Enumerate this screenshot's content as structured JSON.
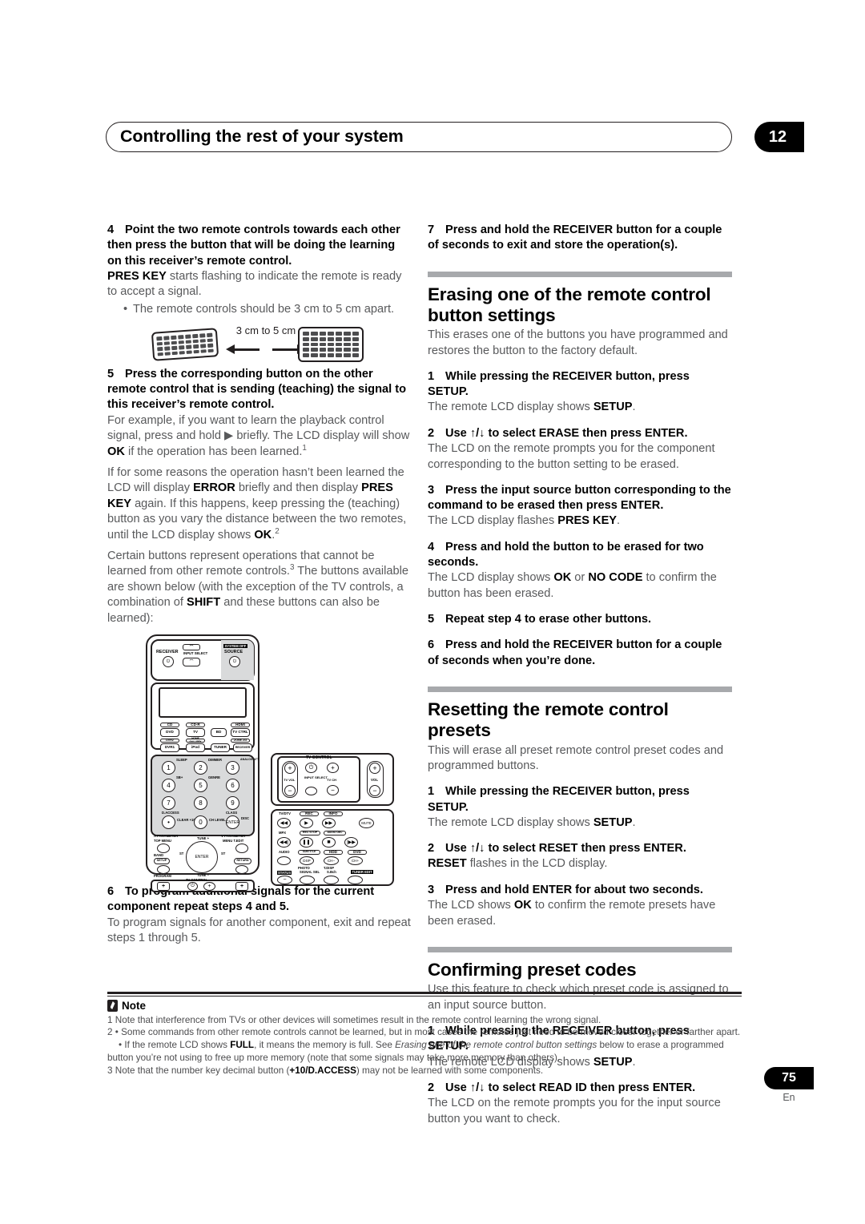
{
  "header": {
    "title": "Controlling the rest of your system",
    "chapter": "12"
  },
  "left_column": {
    "step4": {
      "num": "4",
      "title": "Point the two remote controls towards each other then press the button that will be doing the learning on this receiver’s remote control.",
      "body_prefix": "PRES KEY",
      "body_rest": " starts flashing to indicate the remote is ready to accept a signal.",
      "bullet1": "The remote controls should be 3 cm to 5 cm apart."
    },
    "distance_figure": {
      "label": "3 cm to 5 cm"
    },
    "step5": {
      "num": "5",
      "title": "Press the corresponding button on the other remote control that is sending (teaching) the signal to this receiver’s remote control.",
      "para1_a": "For example, if you want to learn the playback control signal, press and hold ",
      "para1_play": "▶",
      "para1_b": " briefly. The LCD display will show ",
      "para1_ok": "OK",
      "para1_c": " if the operation has been learned.",
      "para1_sup": "1",
      "para2_a": "If for some reasons the operation hasn’t been learned the LCD will display ",
      "para2_error": "ERROR",
      "para2_b": " briefly and then display ",
      "para2_preskey": "PRES KEY",
      "para2_c": " again. If this happens, keep pressing the (teaching) button as you vary the distance between the two remotes, until the LCD display shows ",
      "para2_ok": "OK",
      "para2_d": ".",
      "para2_sup": "2",
      "para3_a": "Certain buttons represent operations that cannot be learned from other remote controls.",
      "para3_sup": "3",
      "para3_b": " The buttons available are shown below (with the exception of the TV controls, a combination of ",
      "para3_shift": "SHIFT",
      "para3_c": " and these buttons can also be learned):"
    },
    "step6": {
      "num": "6",
      "title": "To program additional signals for the current component repeat steps 4 and 5.",
      "body": "To program signals for another component, exit and repeat steps 1 through 5."
    }
  },
  "right_column": {
    "step7": {
      "num": "7",
      "title": "Press and hold the RECEIVER button for a couple of seconds to exit and store the operation(s)."
    },
    "section_erasing": {
      "title": "Erasing one of the remote control button settings",
      "intro": "This erases one of the buttons you have programmed and restores the button to the factory default.",
      "steps": [
        {
          "num": "1",
          "title": "While pressing the RECEIVER button, press SETUP.",
          "body_a": "The remote LCD display shows ",
          "body_b": "SETUP",
          "body_c": "."
        },
        {
          "num": "2",
          "title_a": "Use ",
          "title_arrows": "↑/↓",
          "title_b": " to select ERASE then press ENTER.",
          "body_a": "The LCD on the remote prompts you for the component corresponding to the button setting to be erased.",
          "body_b": "",
          "body_c": ""
        },
        {
          "num": "3",
          "title": "Press the input source button corresponding to the command to be erased then press ENTER.",
          "body_a": "The LCD display flashes ",
          "body_b": "PRES KEY",
          "body_c": "."
        },
        {
          "num": "4",
          "title": "Press and hold the button to be erased for two seconds.",
          "body_a": "The LCD display shows ",
          "body_b": "OK",
          "body_mid": " or ",
          "body_b2": "NO CODE",
          "body_c": " to confirm the button has been erased."
        },
        {
          "num": "5",
          "title": "Repeat step 4 to erase other buttons."
        },
        {
          "num": "6",
          "title": "Press and hold the RECEIVER button for a couple of seconds when you’re done."
        }
      ]
    },
    "section_resetting": {
      "title": "Resetting the remote control presets",
      "intro": "This will erase all preset remote control preset codes and programmed buttons.",
      "steps": [
        {
          "num": "1",
          "title": "While pressing the RECEIVER button, press SETUP.",
          "body_a": "The remote LCD display shows ",
          "body_b": "SETUP",
          "body_c": "."
        },
        {
          "num": "2",
          "title_a": "Use ",
          "title_arrows": "↑/↓",
          "title_b": " to select RESET then press ENTER.",
          "body_a": "",
          "body_b": "RESET",
          "body_c": " flashes in the LCD display."
        },
        {
          "num": "3",
          "title": "Press and hold ENTER for about two seconds.",
          "body_a": "The LCD shows ",
          "body_b": "OK",
          "body_c": " to confirm the remote presets have been erased."
        }
      ]
    },
    "section_confirming": {
      "title": "Confirming preset codes",
      "intro": "Use this feature to check which preset code is assigned to an input source button.",
      "steps": [
        {
          "num": "1",
          "title": "While pressing the RECEIVER button, press SETUP.",
          "body_a": "The remote LCD display shows ",
          "body_b": "SETUP",
          "body_c": "."
        },
        {
          "num": "2",
          "title_a": "Use ",
          "title_arrows": "↑/↓",
          "title_b": " to select READ ID then press ENTER.",
          "body_a": "The LCD on the remote prompts you for the input source button you want to check.",
          "body_b": "",
          "body_c": ""
        }
      ]
    }
  },
  "notes": {
    "title": "Note",
    "icon": "note-pen-icon",
    "items": [
      {
        "num": "1",
        "text": "Note that interference from TVs or other devices will sometimes result in the remote control learning the wrong signal."
      },
      {
        "num": "2",
        "bullet1": "Some commands from other remote controls cannot be learned, but in most cases the remotes just need to be moved closer together or farther apart.",
        "bullet2_a": "If the remote LCD shows ",
        "bullet2_full": "FULL",
        "bullet2_b": ", it means the memory is full. See ",
        "bullet2_italic": "Erasing one of the remote control button settings",
        "bullet2_c": " below to erase a programmed button you’re not using to free up more memory (note that some signals may take more memory than others)."
      },
      {
        "num": "3",
        "text_a": "Note that the number key decimal button (",
        "text_bold": "+10/D.ACCESS",
        "text_b": ") may not be learned with some components."
      }
    ]
  },
  "footer": {
    "page_number": "75",
    "language": "En"
  },
  "remote_figure": {
    "top_labels": {
      "receiver": "RECEIVER",
      "input_select": "INPUT SELECT",
      "system_off": "SYSTEM OFF",
      "source": "SOURCE"
    },
    "source_buttons": [
      [
        "CD",
        "CD-R",
        "HDMI"
      ],
      [
        "DVD",
        "TV",
        "BD",
        "TV CTRL"
      ],
      [
        "DVR2",
        "HOME GALLERY",
        "ZONE 2/3"
      ],
      [
        "DVR1",
        "iPod",
        "TUNER",
        "RECEIVER"
      ]
    ],
    "numeric_keys": [
      "1",
      "2",
      "3",
      "4",
      "5",
      "6",
      "7",
      "8",
      "9",
      "0"
    ],
    "numeric_sublabels": [
      "SLEEP",
      "DIMMER",
      "ANALOG ATT",
      "SB+",
      "GENRE",
      "D.ACCESS",
      "CLEAR +10",
      "CLASS",
      "DISC",
      "CH LEVEL"
    ],
    "nav_labels": {
      "enter": "ENTER",
      "a_parameter": "A PARAMETER",
      "top_menu": "TOP MENU",
      "v_parameter": "V PARAMETER",
      "menu_tedit": "MENU T.EDIT",
      "band": "BAND",
      "setup": "SETUP",
      "program": "PROGRAM",
      "return": "RETURN",
      "tune_up": "TUNE +",
      "tune_down": "TUNE −",
      "st_left": "ST",
      "st_right": "ST",
      "tv_control": "TV CONTROL"
    },
    "right_panel": {
      "tv_control": "TV CONTROL",
      "tv_vol": "TV VOL",
      "input_select": "INPUT SELECT",
      "tv_ch": "TV CH",
      "vol": "VOL",
      "tv_dtv": "TV/DTV",
      "rec": "REC",
      "info": "INFO",
      "mute": "MUTE",
      "mpx": "MPX",
      "rec_stop": "REC STOP",
      "audio_dec": "AUDIO DEC",
      "audio": "AUDIO",
      "subtitle": "SUBTITLE",
      "hdd": "HDD",
      "dvd": "DVD",
      "dsp": "DSP",
      "ch_minus": "CH−",
      "ch_plus": "CH+",
      "photo": "PHOTO",
      "t_disp": "T.DISP",
      "status": "STATUS",
      "signal_sel": "SIGNAL SEL",
      "s_bch": "S.Bch",
      "tuner_edit": "TUNER EDIT"
    }
  }
}
